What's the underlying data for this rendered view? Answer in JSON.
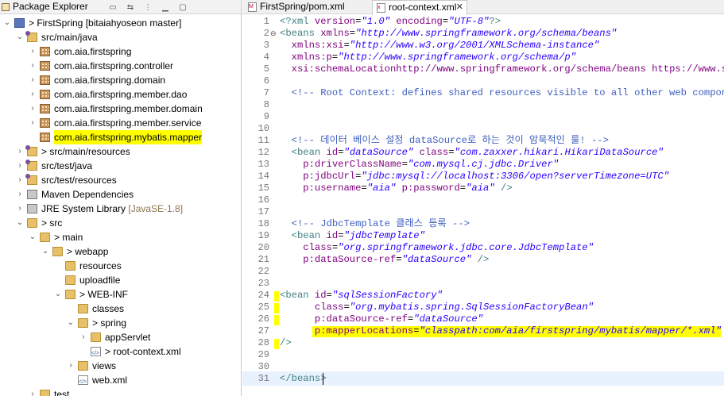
{
  "package_explorer": {
    "title": "Package Explorer",
    "tree": [
      {
        "label": "> FirstSpring [bitaiahyoseon master]",
        "icon": "project-icon",
        "level": 0,
        "expanded": true
      },
      {
        "label": "src/main/java",
        "icon": "source-folder-icon",
        "level": 1,
        "expanded": true
      },
      {
        "label": "com.aia.firstspring",
        "icon": "package-icon",
        "level": 2,
        "expanded": false
      },
      {
        "label": "com.aia.firstspring.controller",
        "icon": "package-icon",
        "level": 2,
        "expanded": false
      },
      {
        "label": "com.aia.firstspring.domain",
        "icon": "package-icon",
        "level": 2,
        "expanded": false
      },
      {
        "label": "com.aia.firstspring.member.dao",
        "icon": "package-icon",
        "level": 2,
        "expanded": false
      },
      {
        "label": "com.aia.firstspring.member.domain",
        "icon": "package-icon",
        "level": 2,
        "expanded": false
      },
      {
        "label": "com.aia.firstspring.member.service",
        "icon": "package-icon",
        "level": 2,
        "expanded": false
      },
      {
        "label": "com.aia.firstspring.mybatis.mapper",
        "icon": "package-icon",
        "level": 2,
        "highlighted": true
      },
      {
        "label": "> src/main/resources",
        "icon": "source-folder-icon",
        "level": 1,
        "expanded": false
      },
      {
        "label": "src/test/java",
        "icon": "source-folder-icon",
        "level": 1,
        "expanded": false
      },
      {
        "label": "src/test/resources",
        "icon": "source-folder-icon",
        "level": 1,
        "expanded": false
      },
      {
        "label": "Maven Dependencies",
        "icon": "library-icon",
        "level": 1,
        "expanded": false
      },
      {
        "label": "JRE System Library",
        "suffix": "[JavaSE-1.8]",
        "icon": "library-icon",
        "level": 1,
        "expanded": false
      },
      {
        "label": "> src",
        "icon": "folder-icon",
        "level": 1,
        "expanded": true
      },
      {
        "label": "> main",
        "icon": "folder-icon",
        "level": 2,
        "expanded": true
      },
      {
        "label": "> webapp",
        "icon": "folder-icon",
        "level": 3,
        "expanded": true
      },
      {
        "label": "resources",
        "icon": "folder-icon",
        "level": 4
      },
      {
        "label": "uploadfile",
        "icon": "folder-icon",
        "level": 4
      },
      {
        "label": "> WEB-INF",
        "icon": "folder-icon",
        "level": 4,
        "expanded": true
      },
      {
        "label": "classes",
        "icon": "folder-icon",
        "level": 5
      },
      {
        "label": "> spring",
        "icon": "folder-icon",
        "level": 5,
        "expanded": true
      },
      {
        "label": "appServlet",
        "icon": "folder-icon",
        "level": 6,
        "expanded": false
      },
      {
        "label": "> root-context.xml",
        "icon": "xml-file-icon",
        "level": 6
      },
      {
        "label": "views",
        "icon": "folder-icon",
        "level": 5,
        "expanded": false
      },
      {
        "label": "web.xml",
        "icon": "xml-file-icon",
        "level": 5
      },
      {
        "label": "test",
        "icon": "folder-icon",
        "level": 2,
        "expanded": false
      }
    ]
  },
  "editor": {
    "tabs": [
      {
        "label": "FirstSpring/pom.xml",
        "active": false
      },
      {
        "label": "root-context.xml",
        "active": true,
        "close": "✕"
      }
    ],
    "lines": [
      {
        "n": "1",
        "text": "<?xml version=\"1.0\" encoding=\"UTF-8\"?>"
      },
      {
        "n": "2",
        "fold": "⊖",
        "text": "<beans xmlns=\"http://www.springframework.org/schema/beans\""
      },
      {
        "n": "3",
        "text": "  xmlns:xsi=\"http://www.w3.org/2001/XMLSchema-instance\""
      },
      {
        "n": "4",
        "text": "  xmlns:p=\"http://www.springframework.org/schema/p\""
      },
      {
        "n": "5",
        "text": "  xsi:schemaLocation=\"http://www.springframework.org/schema/beans https://www.sp"
      },
      {
        "n": "6",
        "text": ""
      },
      {
        "n": "7",
        "text": "  <!-- Root Context: defines shared resources visible to all other web component"
      },
      {
        "n": "8",
        "text": ""
      },
      {
        "n": "9",
        "text": ""
      },
      {
        "n": "10",
        "text": ""
      },
      {
        "n": "11",
        "text": "  <!-- 데이터 베이스 설정 dataSource로 하는 것이 암묵적인 룰! -->"
      },
      {
        "n": "12",
        "text": "  <bean id=\"dataSource\" class=\"com.zaxxer.hikari.HikariDataSource\""
      },
      {
        "n": "13",
        "text": "    p:driverClassName=\"com.mysql.cj.jdbc.Driver\""
      },
      {
        "n": "14",
        "text": "    p:jdbcUrl=\"jdbc:mysql://localhost:3306/open?serverTimezone=UTC\""
      },
      {
        "n": "15",
        "text": "    p:username=\"aia\" p:password=\"aia\" />"
      },
      {
        "n": "16",
        "text": ""
      },
      {
        "n": "17",
        "text": ""
      },
      {
        "n": "18",
        "text": "  <!-- JdbcTemplate 클래스 등록 -->"
      },
      {
        "n": "19",
        "text": "  <bean id=\"jdbcTemplate\""
      },
      {
        "n": "20",
        "text": "    class=\"org.springframework.jdbc.core.JdbcTemplate\""
      },
      {
        "n": "21",
        "text": "    p:dataSource-ref=\"dataSource\" />"
      },
      {
        "n": "22",
        "text": ""
      },
      {
        "n": "23",
        "text": ""
      },
      {
        "n": "24",
        "text": "<bean id=\"sqlSessionFactory\""
      },
      {
        "n": "25",
        "text": "      class=\"org.mybatis.spring.SqlSessionFactoryBean\""
      },
      {
        "n": "26",
        "text": "      p:dataSource-ref=\"dataSource\""
      },
      {
        "n": "27",
        "text": "      p:mapperLocations=\"classpath:com/aia/firstspring/mybatis/mapper/*.xml\""
      },
      {
        "n": "28",
        "text": "/>"
      },
      {
        "n": "29",
        "text": ""
      },
      {
        "n": "30",
        "text": ""
      },
      {
        "n": "31",
        "text": "</beans>"
      }
    ]
  },
  "colors": {
    "highlight": "#ffff00",
    "tag": "#3f7f7f",
    "attribute": "#7f007f",
    "value": "#2a00ff",
    "comment": "#3f5fbf"
  }
}
